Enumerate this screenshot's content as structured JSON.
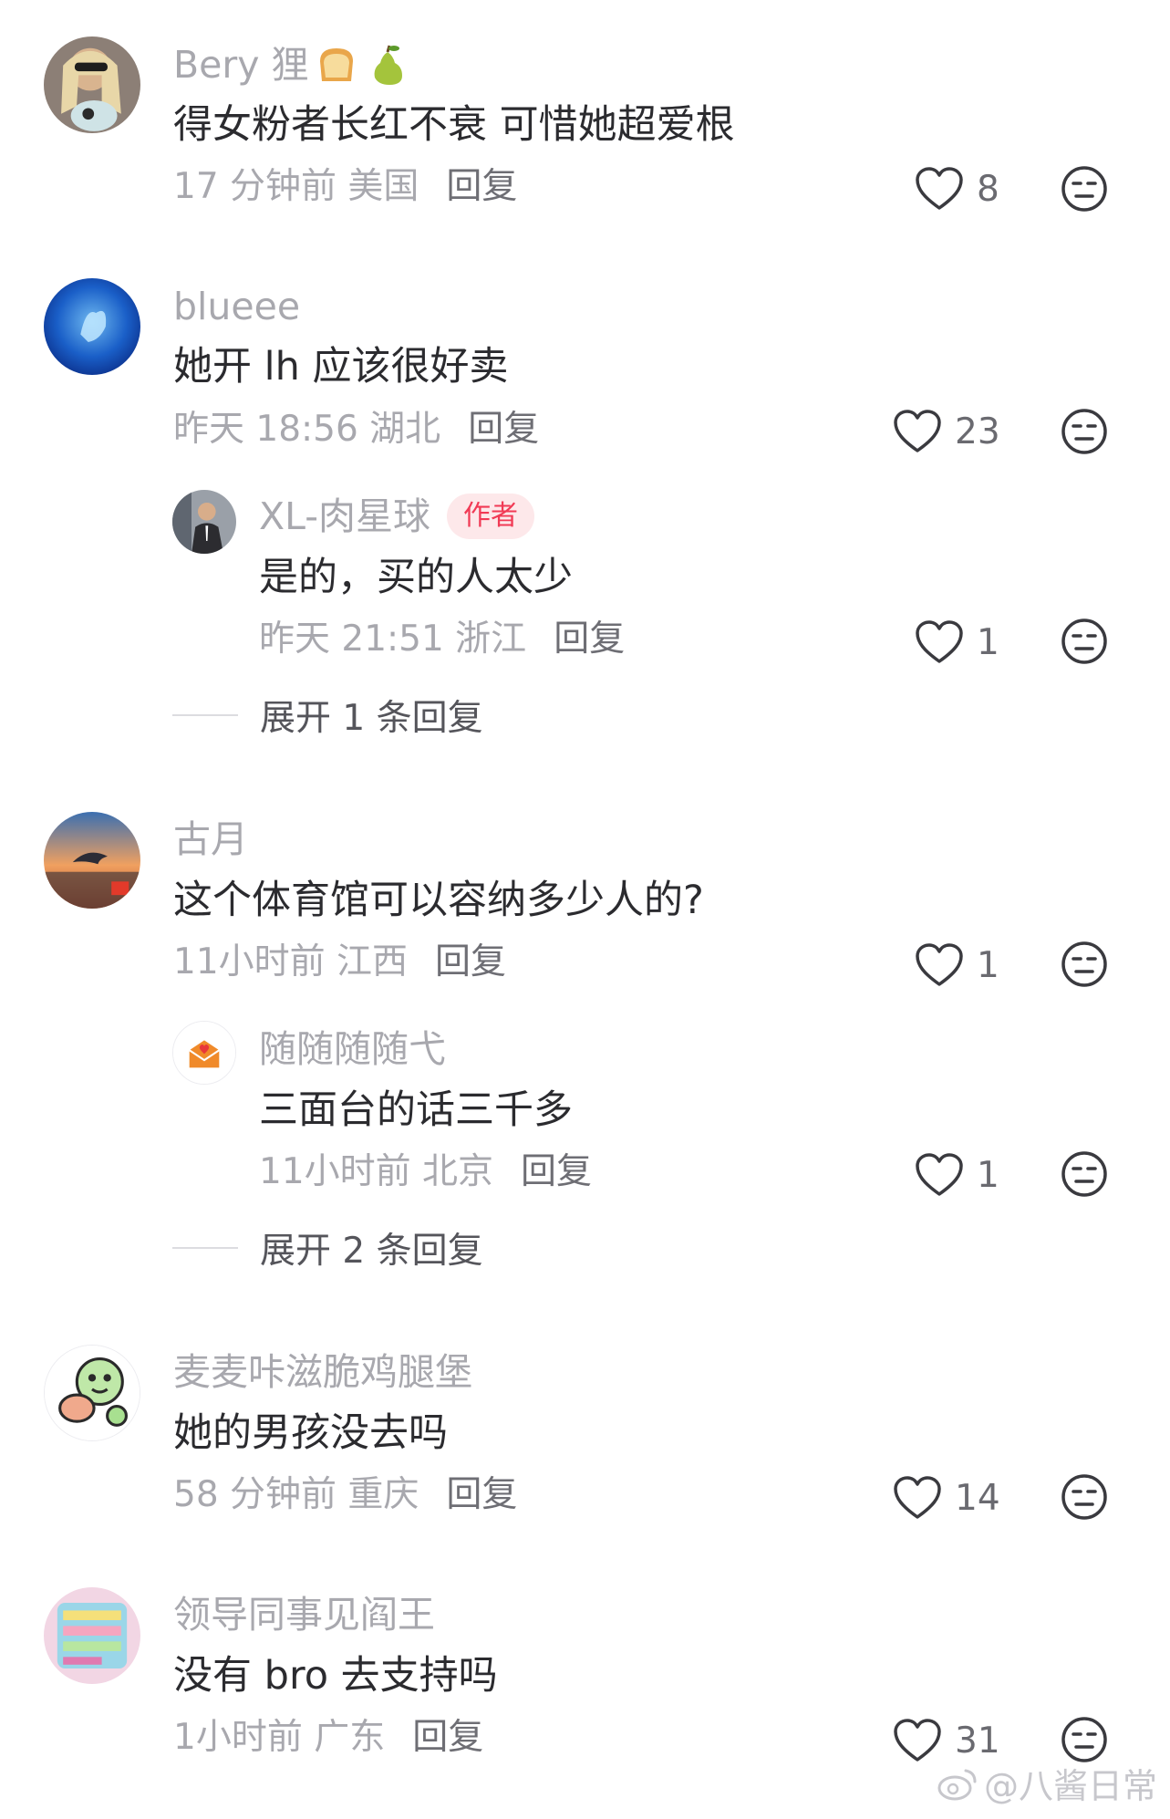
{
  "comments": [
    {
      "username": "Bery 狸",
      "username_emojis": [
        "bread-emoji",
        "pear-emoji"
      ],
      "text": "得女粉者长红不衰 可惜她超爱根",
      "time": "17 分钟前 美国",
      "reply_label": "回复",
      "likes": "8"
    },
    {
      "username": "blueee",
      "text": "她开 lh 应该很好卖",
      "time": "昨天 18:56 湖北",
      "reply_label": "回复",
      "likes": "23",
      "replies": [
        {
          "username": "XL-肉星球",
          "badge": "作者",
          "text": "是的，买的人太少",
          "time": "昨天 21:51 浙江",
          "reply_label": "回复",
          "likes": "1"
        }
      ],
      "expand_label": "展开 1 条回复"
    },
    {
      "username": "古月",
      "text": "这个体育馆可以容纳多少人的?",
      "time": "11小时前 江西",
      "reply_label": "回复",
      "likes": "1",
      "replies": [
        {
          "username": "随随随随弋",
          "text": "三面台的话三千多",
          "time": "11小时前 北京",
          "reply_label": "回复",
          "likes": "1"
        }
      ],
      "expand_label": "展开 2 条回复"
    },
    {
      "username": "麦麦咔滋脆鸡腿堡",
      "text": "她的男孩没去吗",
      "time": "58 分钟前 重庆",
      "reply_label": "回复",
      "likes": "14"
    },
    {
      "username": "领导同事见阎王",
      "text": "没有 bro 去支持吗",
      "time": "1小时前 广东",
      "reply_label": "回复",
      "likes": "31"
    }
  ],
  "watermark": "@八酱日常",
  "colors": {
    "text_primary": "#2b2b2f",
    "text_secondary": "#a8a8ae",
    "author_badge_bg": "#fde8ea",
    "author_badge_text": "#f13a55"
  }
}
